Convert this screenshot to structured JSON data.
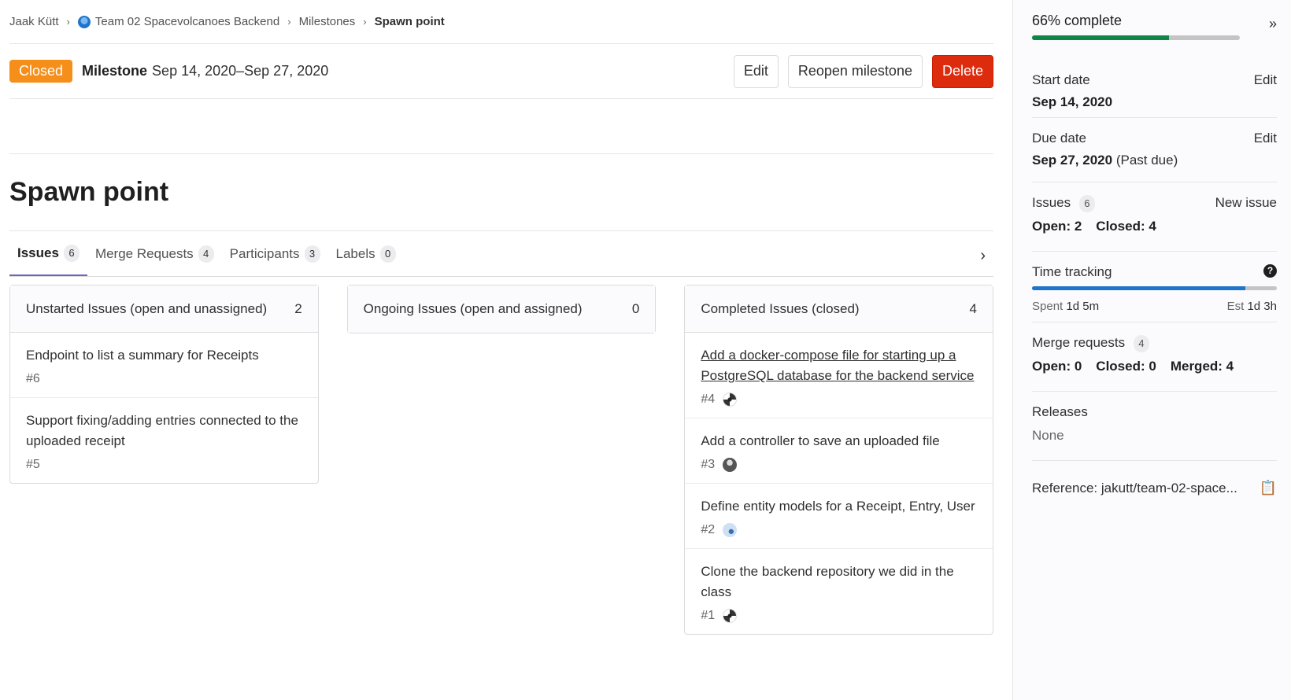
{
  "breadcrumb": {
    "items": [
      "Jaak Kütt",
      "Team 02 Spacevolcanoes Backend",
      "Milestones",
      "Spawn point"
    ]
  },
  "header": {
    "status": "Closed",
    "milestone_label": "Milestone",
    "dates": "Sep 14, 2020–Sep 27, 2020",
    "edit_label": "Edit",
    "reopen_label": "Reopen milestone",
    "delete_label": "Delete"
  },
  "title": "Spawn point",
  "tabs": [
    {
      "label": "Issues",
      "count": "6"
    },
    {
      "label": "Merge Requests",
      "count": "4"
    },
    {
      "label": "Participants",
      "count": "3"
    },
    {
      "label": "Labels",
      "count": "0"
    }
  ],
  "columns": [
    {
      "title": "Unstarted Issues (open and unassigned)",
      "count": "2",
      "issues": [
        {
          "title": "Endpoint to list a summary for Receipts",
          "ref": "#6"
        },
        {
          "title": "Support fixing/adding entries connected to the uploaded receipt",
          "ref": "#5"
        }
      ]
    },
    {
      "title": "Ongoing Issues (open and assigned)",
      "count": "0",
      "issues": []
    },
    {
      "title": "Completed Issues (closed)",
      "count": "4",
      "issues": [
        {
          "title": "Add a docker-compose file for starting up a PostgreSQL database for the backend service",
          "ref": "#4"
        },
        {
          "title": "Add a controller to save an uploaded file",
          "ref": "#3"
        },
        {
          "title": "Define entity models for a Receipt, Entry, User",
          "ref": "#2"
        },
        {
          "title": "Clone the backend repository we did in the class",
          "ref": "#1"
        }
      ]
    }
  ],
  "sidebar": {
    "progress_label": "66% complete",
    "progress": 0.66,
    "start_date": {
      "label": "Start date",
      "edit": "Edit",
      "value": "Sep 14, 2020"
    },
    "due_date": {
      "label": "Due date",
      "edit": "Edit",
      "value": "Sep 27, 2020",
      "note": "(Past due)"
    },
    "issues": {
      "label": "Issues",
      "count": "6",
      "new_issue": "New issue",
      "open": "Open: 2",
      "closed": "Closed: 4"
    },
    "time_tracking": {
      "label": "Time tracking",
      "spent_label": "Spent",
      "spent": "1d 5m",
      "est_label": "Est",
      "est": "1d 3h",
      "progress": 0.87
    },
    "merge_requests": {
      "label": "Merge requests",
      "count": "4",
      "open": "Open: 0",
      "closed": "Closed: 0",
      "merged": "Merged: 4"
    },
    "releases": {
      "label": "Releases",
      "value": "None"
    },
    "reference": "Reference: jakutt/team-02-space..."
  },
  "colors": {
    "closed_badge": "#f68e1a",
    "delete_button": "#dd2b0e",
    "progress_green": "#108548",
    "time_blue": "#1f75cb",
    "active_tab": "#6666c4"
  }
}
